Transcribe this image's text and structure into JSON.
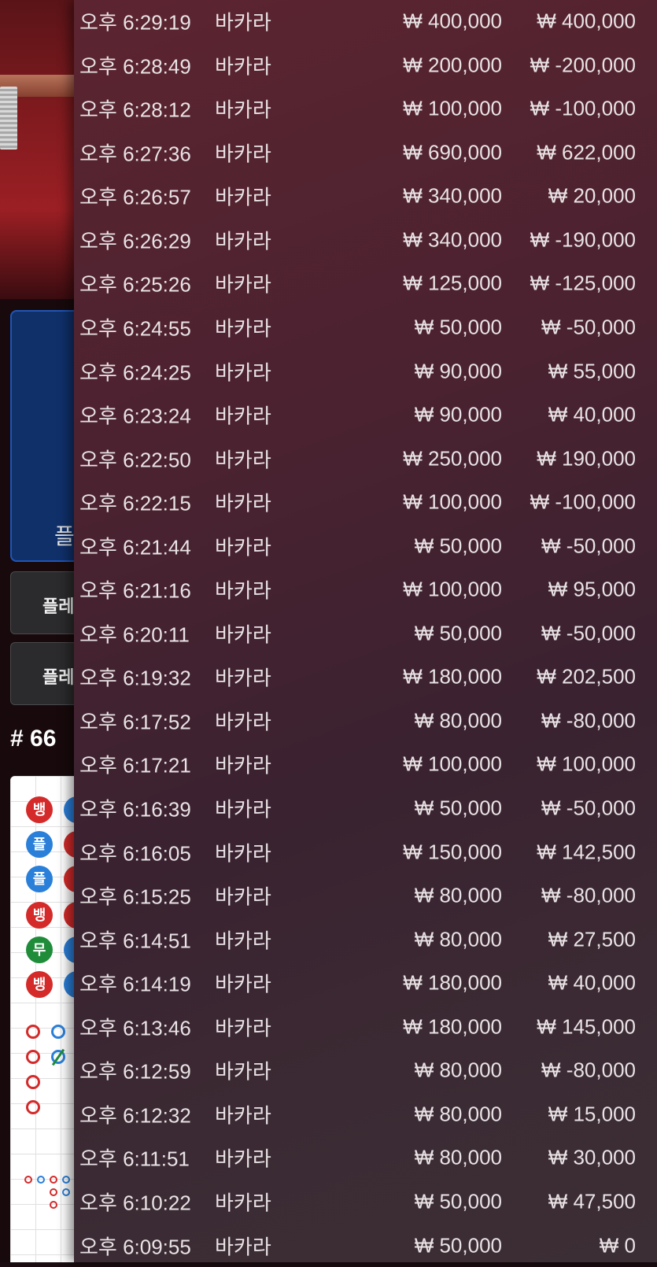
{
  "background": {
    "player_panel_label": "플",
    "buttons": [
      "플레",
      "플레"
    ],
    "round_number": "# 66",
    "bead_road": [
      {
        "text": "뱅",
        "color": "red"
      },
      {
        "text": "플",
        "color": "blue"
      },
      {
        "text": "플",
        "color": "blue"
      },
      {
        "text": "뱅",
        "color": "red"
      },
      {
        "text": "무",
        "color": "green"
      },
      {
        "text": "뱅",
        "color": "red"
      }
    ]
  },
  "history": {
    "rows": [
      {
        "time": "오후 6:29:19",
        "game": "바카라",
        "bet": "₩ 400,000",
        "result": "₩ 400,000"
      },
      {
        "time": "오후 6:28:49",
        "game": "바카라",
        "bet": "₩ 200,000",
        "result": "₩ -200,000"
      },
      {
        "time": "오후 6:28:12",
        "game": "바카라",
        "bet": "₩ 100,000",
        "result": "₩ -100,000"
      },
      {
        "time": "오후 6:27:36",
        "game": "바카라",
        "bet": "₩ 690,000",
        "result": "₩ 622,000"
      },
      {
        "time": "오후 6:26:57",
        "game": "바카라",
        "bet": "₩ 340,000",
        "result": "₩ 20,000"
      },
      {
        "time": "오후 6:26:29",
        "game": "바카라",
        "bet": "₩ 340,000",
        "result": "₩ -190,000"
      },
      {
        "time": "오후 6:25:26",
        "game": "바카라",
        "bet": "₩ 125,000",
        "result": "₩ -125,000"
      },
      {
        "time": "오후 6:24:55",
        "game": "바카라",
        "bet": "₩ 50,000",
        "result": "₩ -50,000"
      },
      {
        "time": "오후 6:24:25",
        "game": "바카라",
        "bet": "₩ 90,000",
        "result": "₩ 55,000"
      },
      {
        "time": "오후 6:23:24",
        "game": "바카라",
        "bet": "₩ 90,000",
        "result": "₩ 40,000"
      },
      {
        "time": "오후 6:22:50",
        "game": "바카라",
        "bet": "₩ 250,000",
        "result": "₩ 190,000"
      },
      {
        "time": "오후 6:22:15",
        "game": "바카라",
        "bet": "₩ 100,000",
        "result": "₩ -100,000"
      },
      {
        "time": "오후 6:21:44",
        "game": "바카라",
        "bet": "₩ 50,000",
        "result": "₩ -50,000"
      },
      {
        "time": "오후 6:21:16",
        "game": "바카라",
        "bet": "₩ 100,000",
        "result": "₩ 95,000"
      },
      {
        "time": "오후 6:20:11",
        "game": "바카라",
        "bet": "₩ 50,000",
        "result": "₩ -50,000"
      },
      {
        "time": "오후 6:19:32",
        "game": "바카라",
        "bet": "₩ 180,000",
        "result": "₩ 202,500"
      },
      {
        "time": "오후 6:17:52",
        "game": "바카라",
        "bet": "₩ 80,000",
        "result": "₩ -80,000"
      },
      {
        "time": "오후 6:17:21",
        "game": "바카라",
        "bet": "₩ 100,000",
        "result": "₩ 100,000"
      },
      {
        "time": "오후 6:16:39",
        "game": "바카라",
        "bet": "₩ 50,000",
        "result": "₩ -50,000"
      },
      {
        "time": "오후 6:16:05",
        "game": "바카라",
        "bet": "₩ 150,000",
        "result": "₩ 142,500"
      },
      {
        "time": "오후 6:15:25",
        "game": "바카라",
        "bet": "₩ 80,000",
        "result": "₩ -80,000"
      },
      {
        "time": "오후 6:14:51",
        "game": "바카라",
        "bet": "₩ 80,000",
        "result": "₩ 27,500"
      },
      {
        "time": "오후 6:14:19",
        "game": "바카라",
        "bet": "₩ 180,000",
        "result": "₩ 40,000"
      },
      {
        "time": "오후 6:13:46",
        "game": "바카라",
        "bet": "₩ 180,000",
        "result": "₩ 145,000"
      },
      {
        "time": "오후 6:12:59",
        "game": "바카라",
        "bet": "₩ 80,000",
        "result": "₩ -80,000"
      },
      {
        "time": "오후 6:12:32",
        "game": "바카라",
        "bet": "₩ 80,000",
        "result": "₩ 15,000"
      },
      {
        "time": "오후 6:11:51",
        "game": "바카라",
        "bet": "₩ 80,000",
        "result": "₩ 30,000"
      },
      {
        "time": "오후 6:10:22",
        "game": "바카라",
        "bet": "₩ 50,000",
        "result": "₩ 47,500"
      },
      {
        "time": "오후 6:09:55",
        "game": "바카라",
        "bet": "₩ 50,000",
        "result": "₩ 0"
      }
    ]
  }
}
